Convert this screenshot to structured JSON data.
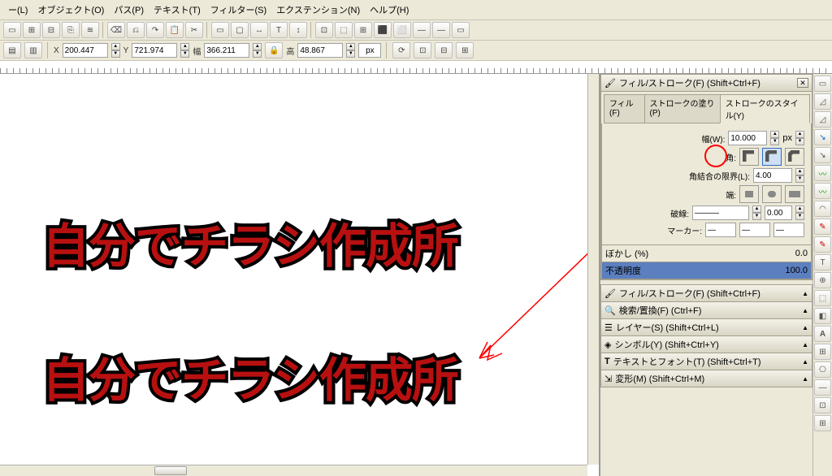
{
  "menu": {
    "layer": "ー(L)",
    "object": "オブジェクト(O)",
    "path": "パス(P)",
    "text": "テキスト(T)",
    "filter": "フィルター(S)",
    "extension": "エクステンション(N)",
    "help": "ヘルプ(H)"
  },
  "toolbar_icons": [
    "▭",
    "⊞",
    "⊟",
    "⎘",
    "≋",
    "⌫",
    "⎌",
    "↷",
    "📋",
    "✂",
    "▭",
    "▢",
    "↔",
    "T",
    "↕",
    "⊡",
    "⬚",
    "⊞",
    "⬛",
    "⬜",
    "—",
    "—",
    "▭"
  ],
  "coords": {
    "x_label": "X",
    "x": "200.447",
    "y_label": "Y",
    "y": "721.974",
    "w_label": "幅",
    "w": "366.211",
    "h_label": "高",
    "h": "48.867",
    "unit": "px"
  },
  "canvas": {
    "text1": "自分でチラシ作成所",
    "text2": "自分でチラシ作成所"
  },
  "fillstroke": {
    "title": "フィル/ストローク(F) (Shift+Ctrl+F)",
    "close": "✕",
    "tab_fill": "フィル(F)",
    "tab_strokepaint": "ストロークの塗り(P)",
    "tab_strokestyle": "ストロークのスタイル(Y)",
    "width_label": "幅(W):",
    "width_val": "10.000",
    "width_unit": "px",
    "join_label": "角:",
    "miter_label": "角結合の限界(L):",
    "miter_val": "4.00",
    "cap_label": "端:",
    "dash_label": "破線:",
    "dash_offset": "0.00",
    "marker_label": "マーカー:",
    "blur_label": "ぼかし (%)",
    "blur_val": "0.0",
    "opacity_label": "不透明度",
    "opacity_val": "100.0"
  },
  "dock": {
    "d1": "フィル/ストローク(F) (Shift+Ctrl+F)",
    "d2": "検索/置換(F) (Ctrl+F)",
    "d3": "レイヤー(S) (Shift+Ctrl+L)",
    "d4": "シンボル(Y) (Shift+Ctrl+Y)",
    "d5": "テキストとフォント(T) (Shift+Ctrl+T)",
    "d6": "変形(M) (Shift+Ctrl+M)"
  },
  "vtools": [
    "▭",
    "◿",
    "◿",
    "↘",
    "↘",
    "〰",
    "〰",
    "◠",
    "✎",
    "✎",
    "T",
    "⊕",
    "⬚",
    "◧",
    "A",
    "⊞",
    "⎔",
    "—",
    "⊡",
    "⊞"
  ]
}
